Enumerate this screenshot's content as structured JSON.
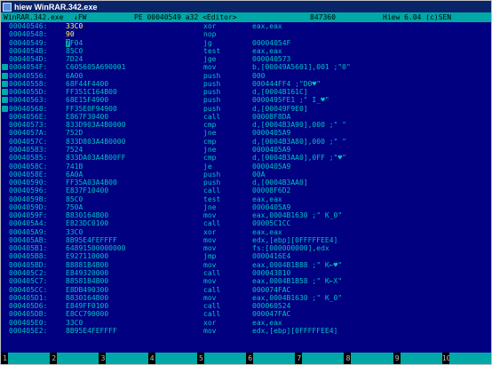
{
  "window": {
    "title": "hiew WinRAR.342.exe"
  },
  "status": {
    "file": "WinRAR.342.exe",
    "flag": "↓FW",
    "mode": "PE 00040549 a32 <Editor>",
    "size": "847360",
    "version": "Hiew 6.04 (c)SEN"
  },
  "rows": [
    {
      "marker": false,
      "addr": "00040546:",
      "hex": "33C0",
      "hi": true,
      "mnem": "xor",
      "ops": "eax,eax"
    },
    {
      "marker": false,
      "addr": "00040548:",
      "hex": "90",
      "hi": true,
      "mnem": "nop",
      "ops": ""
    },
    {
      "marker": false,
      "addr": "00040549:",
      "hex": "7F04",
      "hi": false,
      "cursor": "7",
      "rest": "F04",
      "mnem": "jg",
      "ops": "00004054F"
    },
    {
      "marker": false,
      "addr": "0004054B:",
      "hex": "85C0",
      "hi": false,
      "mnem": "test",
      "ops": "eax,eax"
    },
    {
      "marker": false,
      "addr": "0004054D:",
      "hex": "7D24",
      "hi": false,
      "mnem": "jge",
      "ops": "000040573"
    },
    {
      "marker": true,
      "addr": "0004054F:",
      "hex": "C605605A690001",
      "hi": false,
      "mnem": "mov",
      "ops": "b,[00049A5601],001 ;\"0\""
    },
    {
      "marker": true,
      "addr": "00040556:",
      "hex": "6A00",
      "hi": false,
      "mnem": "push",
      "ops": "000"
    },
    {
      "marker": true,
      "addr": "00040558:",
      "hex": "68F44F4400",
      "hi": false,
      "mnem": "push",
      "ops": "000444FF4 ;\"D0♥\""
    },
    {
      "marker": true,
      "addr": "0004055D:",
      "hex": "FF351C164B00",
      "hi": false,
      "mnem": "push",
      "ops": "d,[0004B161C]"
    },
    {
      "marker": true,
      "addr": "00040563:",
      "hex": "68E15F4900",
      "hi": false,
      "mnem": "push",
      "ops": "0000495FE1 ;\" I_♥\""
    },
    {
      "marker": true,
      "addr": "00040568:",
      "hex": "FF35E0F94900",
      "hi": false,
      "mnem": "push",
      "ops": "d,[00049F9E0]"
    },
    {
      "marker": false,
      "addr": "0004056E:",
      "hex": "E867F30400",
      "hi": false,
      "mnem": "call",
      "ops": "00008F8DA"
    },
    {
      "marker": false,
      "addr": "00040573:",
      "hex": "833D903A4B0000",
      "hi": false,
      "mnem": "cmp",
      "ops": "d,[0004B3A90],000 ;\" \""
    },
    {
      "marker": false,
      "addr": "0004057A:",
      "hex": "752D",
      "hi": false,
      "mnem": "jne",
      "ops": "0000405A9"
    },
    {
      "marker": false,
      "addr": "0004057C:",
      "hex": "833D803A4B0000",
      "hi": false,
      "mnem": "cmp",
      "ops": "d,[0004B3A80],000 ;\" \""
    },
    {
      "marker": false,
      "addr": "00040583:",
      "hex": "7524",
      "hi": false,
      "mnem": "jne",
      "ops": "0000405A9"
    },
    {
      "marker": false,
      "addr": "00040585:",
      "hex": "833DA03A4B00FF",
      "hi": false,
      "mnem": "cmp",
      "ops": "d,[0004B3AA0],0FF ;\"♥\""
    },
    {
      "marker": false,
      "addr": "0004058C:",
      "hex": "741B",
      "hi": false,
      "mnem": "je",
      "ops": "0000405A9"
    },
    {
      "marker": false,
      "addr": "0004058E:",
      "hex": "6A0A",
      "hi": false,
      "mnem": "push",
      "ops": "00A"
    },
    {
      "marker": false,
      "addr": "00040590:",
      "hex": "FF35A03A4B00",
      "hi": false,
      "mnem": "push",
      "ops": "d,[0004B3AA0]"
    },
    {
      "marker": false,
      "addr": "00040596:",
      "hex": "E837F10400",
      "hi": false,
      "mnem": "call",
      "ops": "00008F6D2"
    },
    {
      "marker": false,
      "addr": "0004059B:",
      "hex": "85C0",
      "hi": false,
      "mnem": "test",
      "ops": "eax,eax"
    },
    {
      "marker": false,
      "addr": "0004059D:",
      "hex": "750A",
      "hi": false,
      "mnem": "jne",
      "ops": "0000405A9"
    },
    {
      "marker": false,
      "addr": "0004059F:",
      "hex": "B830164B00",
      "hi": false,
      "mnem": "mov",
      "ops": "eax,0004B1630 ;\" K_0\""
    },
    {
      "marker": false,
      "addr": "000405A4:",
      "hex": "E823DC0100",
      "hi": false,
      "mnem": "call",
      "ops": "00005C1CC"
    },
    {
      "marker": false,
      "addr": "000405A9:",
      "hex": "33C0",
      "hi": false,
      "mnem": "xor",
      "ops": "eax,eax"
    },
    {
      "marker": false,
      "addr": "000405AB:",
      "hex": "8B95E4FEFFFF",
      "hi": false,
      "mnem": "mov",
      "ops": "edx,[ebp][0FFFFFEE4]"
    },
    {
      "marker": false,
      "addr": "000405B1:",
      "hex": "64891500000000",
      "hi": false,
      "mnem": "mov",
      "ops": "fs:[000000000],edx"
    },
    {
      "marker": false,
      "addr": "000405B8:",
      "hex": "E927110000",
      "hi": false,
      "mnem": "jmp",
      "ops": "0000416E4"
    },
    {
      "marker": false,
      "addr": "000405BD:",
      "hex": "B8881B4B00",
      "hi": false,
      "mnem": "mov",
      "ops": "eax,0004B1B88 ;\" K←♥\""
    },
    {
      "marker": false,
      "addr": "000405C2:",
      "hex": "E849320000",
      "hi": false,
      "mnem": "call",
      "ops": "000043810"
    },
    {
      "marker": false,
      "addr": "000405C7:",
      "hex": "B8581B4B00",
      "hi": false,
      "mnem": "mov",
      "ops": "eax,0004B1B58 ;\" K←X\""
    },
    {
      "marker": false,
      "addr": "000405CC:",
      "hex": "E8DB490300",
      "hi": false,
      "mnem": "call",
      "ops": "000074FAC"
    },
    {
      "marker": false,
      "addr": "000405D1:",
      "hex": "B830164B00",
      "hi": false,
      "mnem": "mov",
      "ops": "eax,0004B1630 ;\" K_0\""
    },
    {
      "marker": false,
      "addr": "000405D6:",
      "hex": "E849FF0100",
      "hi": false,
      "mnem": "call",
      "ops": "000060524"
    },
    {
      "marker": false,
      "addr": "000405DB:",
      "hex": "E8CC790000",
      "hi": false,
      "mnem": "call",
      "ops": "000047FAC"
    },
    {
      "marker": false,
      "addr": "000405E0:",
      "hex": "33C0",
      "hi": false,
      "mnem": "xor",
      "ops": "eax,eax"
    },
    {
      "marker": false,
      "addr": "000405E2:",
      "hex": "8B95E4FEFFFF",
      "hi": false,
      "mnem": "mov",
      "ops": "edx,[ebp][0FFFFFEE4]"
    }
  ],
  "fkeys": [
    {
      "num": "1",
      "label": ""
    },
    {
      "num": "2",
      "label": ""
    },
    {
      "num": "3",
      "label": ""
    },
    {
      "num": "4",
      "label": ""
    },
    {
      "num": "5",
      "label": ""
    },
    {
      "num": "6",
      "label": ""
    },
    {
      "num": "7",
      "label": ""
    },
    {
      "num": "8",
      "label": ""
    },
    {
      "num": "9",
      "label": ""
    },
    {
      "num": "10",
      "label": ""
    }
  ],
  "colors": {
    "background": "#000080",
    "text": "#00c0c0",
    "highlight": "#ffff55",
    "bar": "#00a8a8"
  }
}
